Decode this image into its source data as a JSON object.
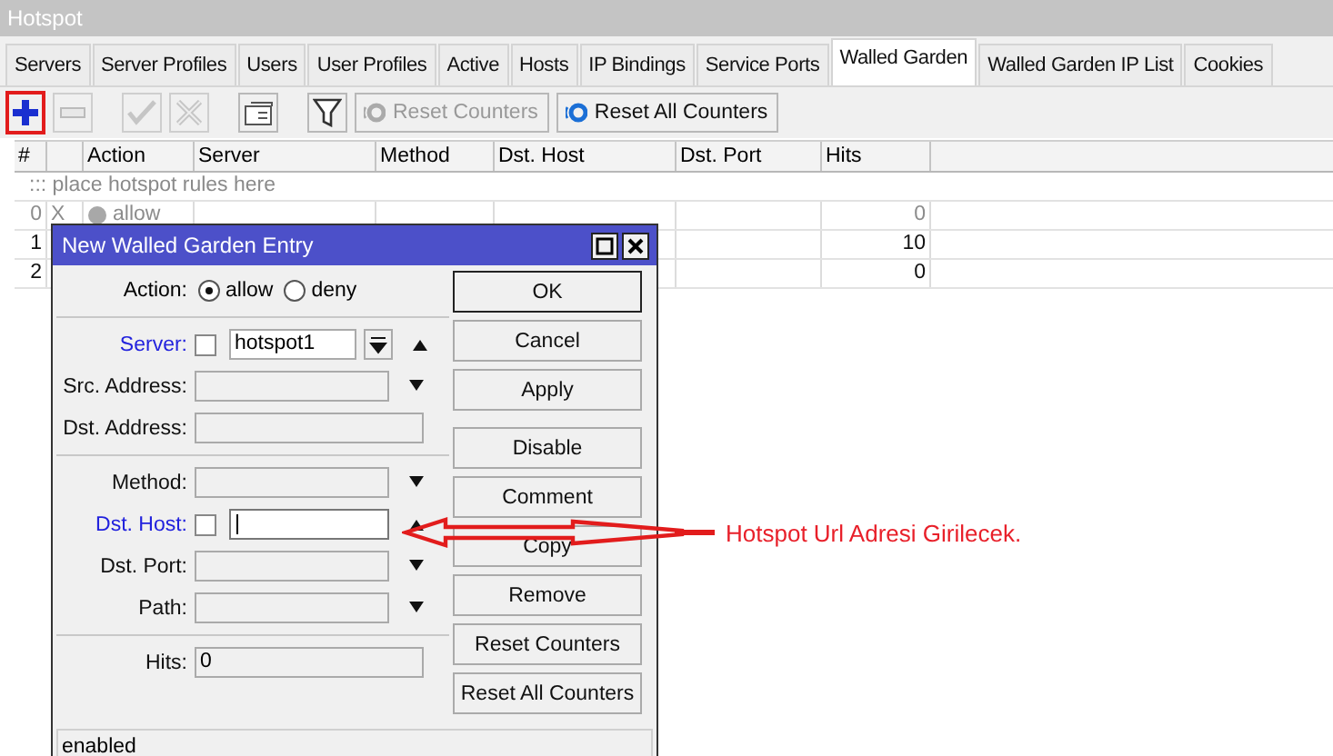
{
  "window": {
    "title": "Hotspot"
  },
  "tabs": [
    {
      "label": "Servers",
      "selected": false
    },
    {
      "label": "Server Profiles",
      "selected": false
    },
    {
      "label": "Users",
      "selected": false
    },
    {
      "label": "User Profiles",
      "selected": false
    },
    {
      "label": "Active",
      "selected": false
    },
    {
      "label": "Hosts",
      "selected": false
    },
    {
      "label": "IP Bindings",
      "selected": false
    },
    {
      "label": "Service Ports",
      "selected": false
    },
    {
      "label": "Walled Garden",
      "selected": true
    },
    {
      "label": "Walled Garden IP List",
      "selected": false
    },
    {
      "label": "Cookies",
      "selected": false
    }
  ],
  "toolbar": {
    "icon_buttons": [
      {
        "kind": "add",
        "disabled": false,
        "highlighted": true
      },
      {
        "kind": "remove",
        "disabled": true,
        "highlighted": false
      },
      {
        "kind": "enable",
        "disabled": true,
        "highlighted": false
      },
      {
        "kind": "disable",
        "disabled": true,
        "highlighted": false
      },
      {
        "kind": "comment",
        "disabled": false,
        "highlighted": false
      },
      {
        "kind": "filter",
        "disabled": false,
        "highlighted": false
      }
    ],
    "text_buttons": [
      {
        "label": "Reset Counters",
        "disabled": true
      },
      {
        "label": "Reset All Counters",
        "disabled": false
      }
    ]
  },
  "table": {
    "columns": [
      {
        "label": "#"
      },
      {
        "label": "Action"
      },
      {
        "label": "Server"
      },
      {
        "label": "Method"
      },
      {
        "label": "Dst. Host"
      },
      {
        "label": "Dst. Port"
      },
      {
        "label": "Hits"
      }
    ],
    "comment": "::: place hotspot rules here",
    "rows": [
      {
        "number": "0",
        "flag": "X",
        "action": "allow",
        "hits": "0",
        "disabled": true
      },
      {
        "number": "1",
        "hits": "10",
        "disabled": false
      },
      {
        "number": "2",
        "hits": "0",
        "disabled": false
      }
    ]
  },
  "dialog": {
    "title": "New Walled Garden Entry",
    "action": {
      "label": "Action:",
      "options": [
        {
          "label": "allow",
          "selected": true
        },
        {
          "label": "deny",
          "selected": false
        }
      ]
    },
    "sections": [
      [
        {
          "kind": "toggle-combo",
          "label": "Server:",
          "value": "hotspot1",
          "checked": false,
          "highlighted": true,
          "focused": false
        },
        {
          "kind": "combo",
          "label": "Src. Address:",
          "highlighted": false,
          "focused": false
        },
        {
          "kind": "text",
          "label": "Dst. Address:",
          "highlighted": false,
          "focused": false
        }
      ],
      [
        {
          "kind": "combo",
          "label": "Method:",
          "highlighted": false,
          "focused": false
        },
        {
          "kind": "toggle-text",
          "label": "Dst. Host:",
          "checked": false,
          "highlighted": true,
          "focused": true
        },
        {
          "kind": "combo",
          "label": "Dst. Port:",
          "highlighted": false,
          "focused": false
        },
        {
          "kind": "combo",
          "label": "Path:",
          "highlighted": false,
          "focused": false
        }
      ],
      [
        {
          "kind": "readonly",
          "label": "Hits:",
          "value": "0",
          "highlighted": false,
          "focused": false
        }
      ]
    ],
    "button_groups": [
      [
        {
          "label": "OK",
          "default": true
        },
        {
          "label": "Cancel",
          "default": false
        },
        {
          "label": "Apply",
          "default": false
        }
      ],
      [
        {
          "label": "Disable",
          "default": false
        },
        {
          "label": "Comment",
          "default": false
        },
        {
          "label": "Copy",
          "default": false
        },
        {
          "label": "Remove",
          "default": false
        },
        {
          "label": "Reset Counters",
          "default": false
        },
        {
          "label": "Reset All Counters",
          "default": false
        }
      ]
    ],
    "status": "enabled"
  },
  "annotation": {
    "text": "Hotspot Url Adresi Girilecek."
  }
}
